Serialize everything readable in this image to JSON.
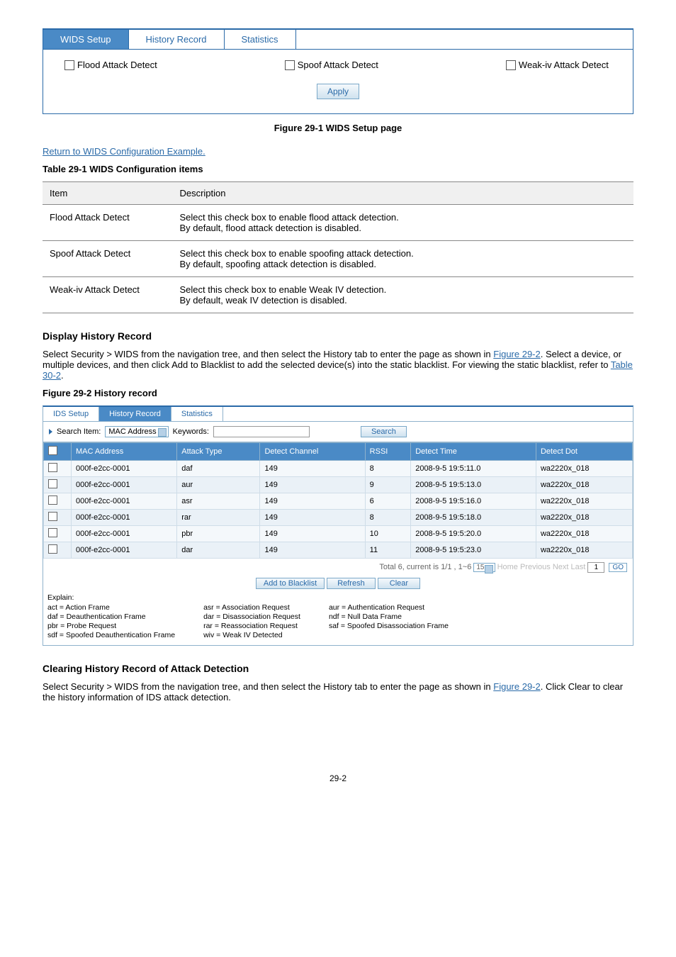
{
  "fig1": {
    "tabs": [
      "WIDS Setup",
      "History Record",
      "Statistics"
    ],
    "checks": [
      "Flood Attack Detect",
      "Spoof Attack Detect",
      "Weak-iv Attack Detect"
    ],
    "apply": "Apply",
    "caption": "Figure 29-1 WIDS Setup page"
  },
  "link_return": "Return to WIDS Configuration Example.",
  "table_caption": "Table 29-1 WIDS Configuration items",
  "table1": {
    "headers": [
      "Item",
      "Description"
    ],
    "rows": [
      [
        "Flood Attack Detect",
        "Select this check box to enable flood attack detection.\nBy default, flood attack detection is disabled."
      ],
      [
        "Spoof Attack Detect",
        "Select this check box to enable spoofing attack detection.\nBy default, spoofing attack detection is disabled."
      ],
      [
        "Weak-iv Attack Detect",
        "Select this check box to enable Weak IV detection.\nBy default, weak IV detection is disabled."
      ]
    ]
  },
  "hist_title": "Display History Record",
  "hist_para_1": "Select Security > WIDS from the navigation tree, and then select the History tab to enter the page as shown in ",
  "hist_fig_ref": "Figure 29-2",
  "hist_para_2": ". Select a device, or multiple devices, and then click Add to Blacklist to add the selected device(s) into the static blacklist. For viewing the static blacklist, refer to ",
  "hist_link_ref": "Table 30-2",
  "fig2_caption": "Figure 29-2 History record",
  "fig2": {
    "tabs": [
      "IDS Setup",
      "History Record",
      "Statistics"
    ],
    "search_label": "Search Item:",
    "search_select": "MAC Address",
    "keywords_label": "Keywords:",
    "search_btn": "Search",
    "headers": [
      "",
      "MAC Address",
      "Attack Type",
      "Detect Channel",
      "RSSI",
      "Detect Time",
      "Detect Dot"
    ],
    "rows": [
      [
        "000f-e2cc-0001",
        "daf",
        "149",
        "8",
        "2008-9-5 19:5:11.0",
        "wa2220x_018"
      ],
      [
        "000f-e2cc-0001",
        "aur",
        "149",
        "9",
        "2008-9-5 19:5:13.0",
        "wa2220x_018"
      ],
      [
        "000f-e2cc-0001",
        "asr",
        "149",
        "6",
        "2008-9-5 19:5:16.0",
        "wa2220x_018"
      ],
      [
        "000f-e2cc-0001",
        "rar",
        "149",
        "8",
        "2008-9-5 19:5:18.0",
        "wa2220x_018"
      ],
      [
        "000f-e2cc-0001",
        "pbr",
        "149",
        "10",
        "2008-9-5 19:5:20.0",
        "wa2220x_018"
      ],
      [
        "000f-e2cc-0001",
        "dar",
        "149",
        "11",
        "2008-9-5 19:5:23.0",
        "wa2220x_018"
      ]
    ],
    "pager_total": "Total 6, current is 1/1 , 1~6",
    "pager_size": "15",
    "pager_links": [
      "Home",
      "Previous",
      "Next",
      "Last"
    ],
    "pager_page": "1",
    "pager_go": "GO",
    "actions": [
      "Add to Blacklist",
      "Refresh",
      "Clear"
    ],
    "explain_title": "Explain:",
    "explain_cols": [
      [
        "act = Action Frame",
        "daf = Deauthentication Frame",
        "pbr = Probe Request",
        "sdf = Spoofed Deauthentication Frame"
      ],
      [
        "asr = Association Request",
        "dar = Disassociation Request",
        "rar = Reassociation Request",
        "wiv = Weak IV Detected"
      ],
      [
        "aur = Authentication Request",
        "ndf = Null Data Frame",
        "saf = Spoofed Disassociation Frame"
      ]
    ]
  },
  "clear_title": "Clearing History Record of Attack Detection",
  "clear_para_1": "Select Security > WIDS from the navigation tree, and then select the History tab to enter the page as shown in ",
  "clear_fig_ref": "Figure 29-2",
  "clear_para_2": ". Click Clear to clear the history information of IDS attack detection.",
  "page_num": "29-2"
}
